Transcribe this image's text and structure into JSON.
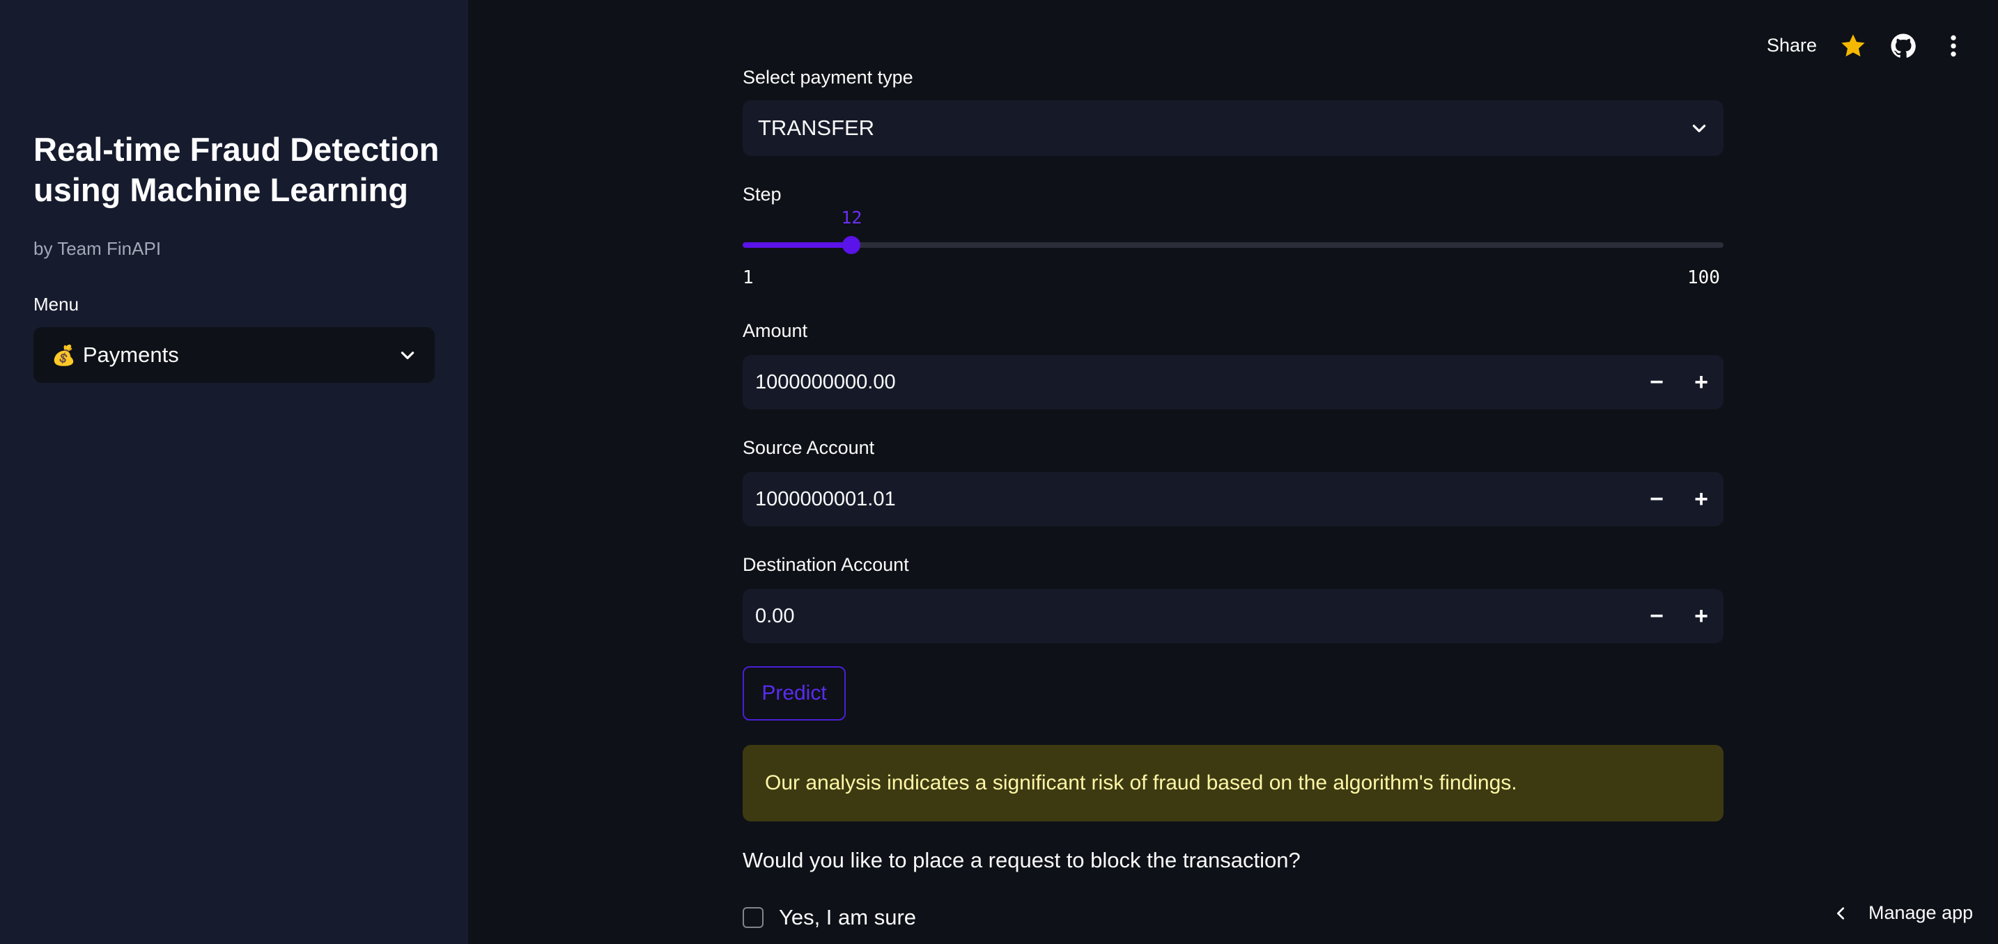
{
  "sidebar": {
    "title": "Real-time Fraud Detection using Machine Learning",
    "subtitle": "by Team FinAPI",
    "menu_label": "Menu",
    "menu_icon": "💰",
    "menu_selected": "Payments"
  },
  "header": {
    "share_label": "Share",
    "star_icon": "star-icon",
    "github_icon": "github-icon",
    "more_icon": "more-vertical-icon",
    "star_color": "#f5b800"
  },
  "form": {
    "payment_type_label": "Select payment type",
    "payment_type_value": "TRANSFER",
    "step_label": "Step",
    "step_value": "12",
    "step_min": "1",
    "step_max": "100",
    "amount_label": "Amount",
    "amount_value": "1000000000.00",
    "source_label": "Source Account",
    "source_value": "1000000001.01",
    "destination_label": "Destination Account",
    "destination_value": "0.00",
    "minus": "−",
    "plus": "+",
    "predict_label": "Predict"
  },
  "result": {
    "alert_text": "Our analysis indicates a significant risk of fraud based on the algorithm's findings.",
    "question": "Would you like to place a request to block the transaction?",
    "checkbox_label": "Yes, I am sure"
  },
  "footer": {
    "manage_label": "Manage app"
  },
  "colors": {
    "accent": "#5a13e8",
    "warning_bg": "#3d3a12",
    "warning_text": "#fdf6a6"
  }
}
